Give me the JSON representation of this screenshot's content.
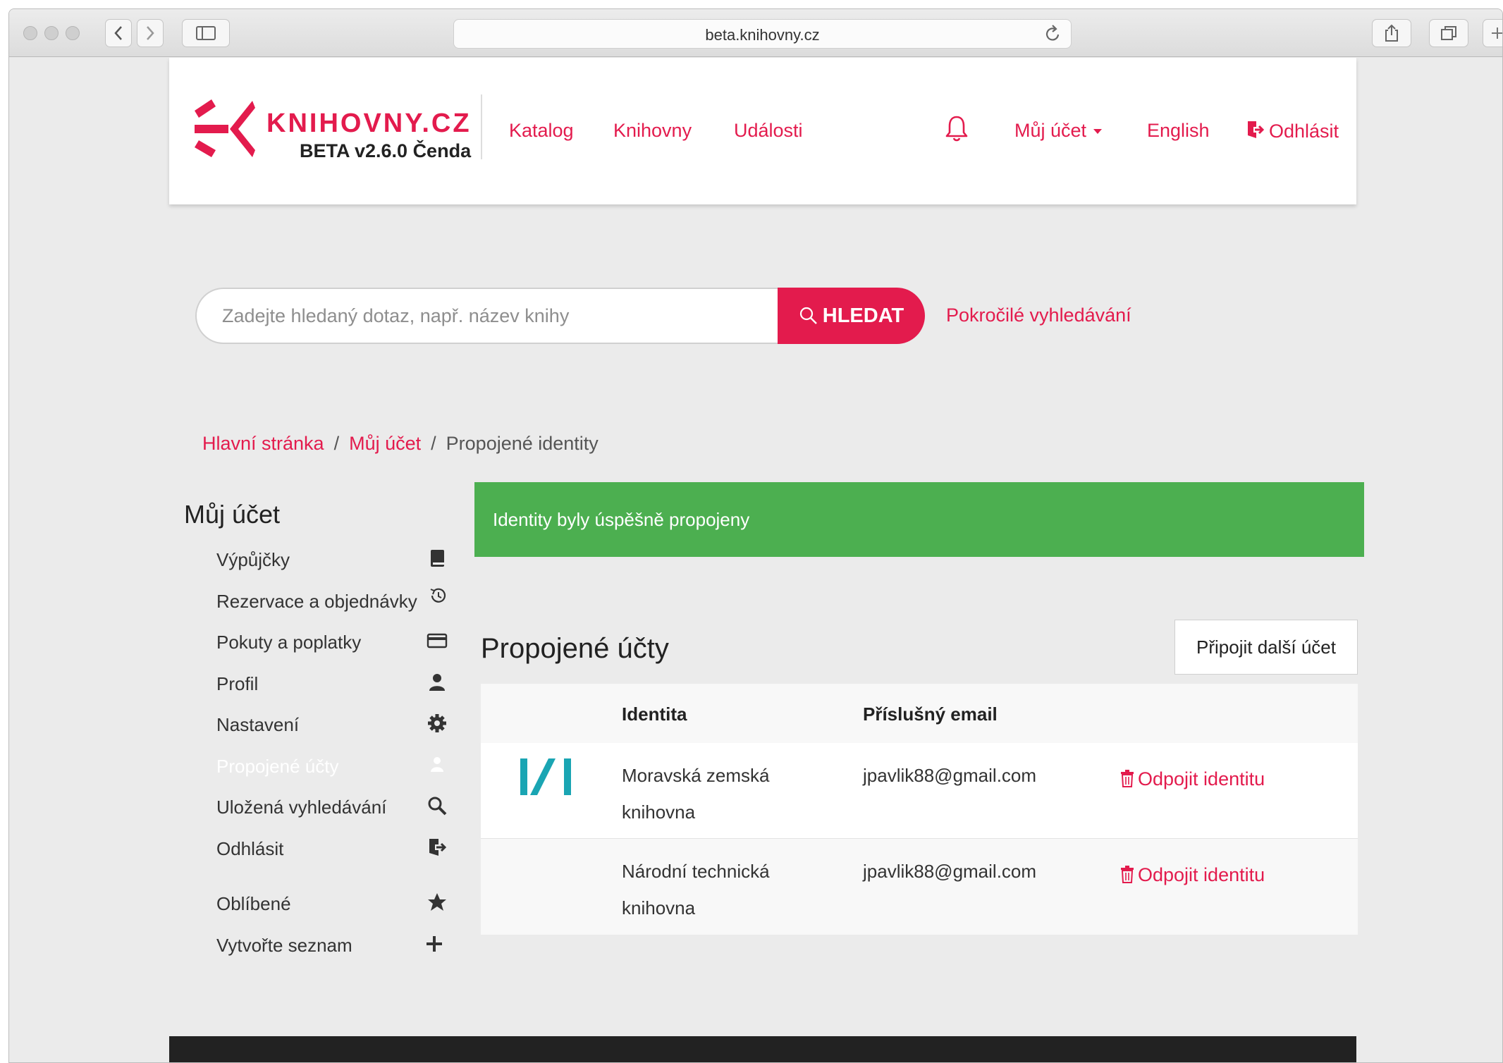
{
  "browser": {
    "url": "beta.knihovny.cz"
  },
  "header": {
    "logo_text": "KNIHOVNY.CZ",
    "logo_subtitle": "BETA v2.6.0 Čenda",
    "nav": [
      "Katalog",
      "Knihovny",
      "Události"
    ],
    "account_label": "Můj účet",
    "language_label": "English",
    "logout_label": "Odhlásit"
  },
  "search": {
    "placeholder": "Zadejte hledaný dotaz, např. název knihy",
    "button_label": "HLEDAT",
    "advanced_label": "Pokročilé vyhledávání"
  },
  "breadcrumb": {
    "items": [
      "Hlavní stránka",
      "Můj účet"
    ],
    "current": "Propojené identity",
    "separator": "/"
  },
  "sidebar": {
    "title": "Můj účet",
    "items": [
      {
        "label": "Výpůjčky",
        "icon": "book-icon"
      },
      {
        "label": "Rezervace a objednávky",
        "icon": "history-icon"
      },
      {
        "label": "Pokuty a poplatky",
        "icon": "credit-card-icon"
      },
      {
        "label": "Profil",
        "icon": "user-icon"
      },
      {
        "label": "Nastavení",
        "icon": "gear-icon"
      },
      {
        "label": "Propojené účty",
        "icon": "linked-users-icon",
        "active": true
      },
      {
        "label": "Uložená vyhledávání",
        "icon": "search-icon"
      },
      {
        "label": "Odhlásit",
        "icon": "logout-icon"
      },
      {
        "label": "Oblíbené",
        "icon": "star-icon"
      },
      {
        "label": "Vytvořte seznam",
        "icon": "plus-icon"
      }
    ]
  },
  "alert": {
    "message": "Identity byly úspěšně propojeny",
    "color": "#4caf50"
  },
  "linked_accounts": {
    "title": "Propojené účty",
    "connect_button": "Připojit další účet",
    "columns": [
      "Identita",
      "Příslušný email"
    ],
    "rows": [
      {
        "identity_line1": "Moravská zemská",
        "identity_line2": "knihovna",
        "email": "jpavlik88@gmail.com",
        "action": "Odpojit identitu",
        "logo": "mzk-logo-icon"
      },
      {
        "identity_line1": "Národní technická",
        "identity_line2": "knihovna",
        "email": "jpavlik88@gmail.com",
        "action": "Odpojit identitu",
        "logo": ""
      }
    ]
  },
  "colors": {
    "brand": "#e31b4d",
    "success": "#4caf50",
    "mzk_logo": "#1aa5b3"
  }
}
